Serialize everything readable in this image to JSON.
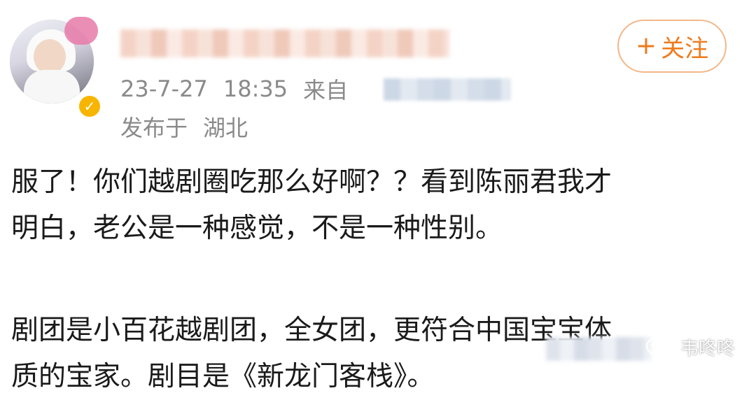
{
  "post": {
    "author": {
      "avatar": "avatar-photo",
      "verified_icon": "verified-badge-icon",
      "name": ""
    },
    "follow_button": {
      "plus": "+",
      "label": "关注"
    },
    "meta": {
      "date": "23-7-27",
      "time": "18:35",
      "source_prefix": "来自"
    },
    "location": {
      "prefix": "发布于",
      "place": "湖北"
    },
    "content": {
      "lines": [
        "服了！你们越剧圈吃那么好啊？？看到陈丽君我才",
        "明白，老公是一种感觉，不是一种性别。",
        "剧团是小百花越剧团，全女团，更符合中国宝宝体",
        "质的宝家。剧目是《新龙门客栈》。"
      ]
    }
  },
  "watermark": {
    "icon": "wechat-icon",
    "text": "韦咚咚"
  },
  "colors": {
    "accent": "#ee7a1b",
    "meta_text": "#8a8a8a",
    "body_text": "#1a1a1a",
    "badge": "#f7b500"
  }
}
